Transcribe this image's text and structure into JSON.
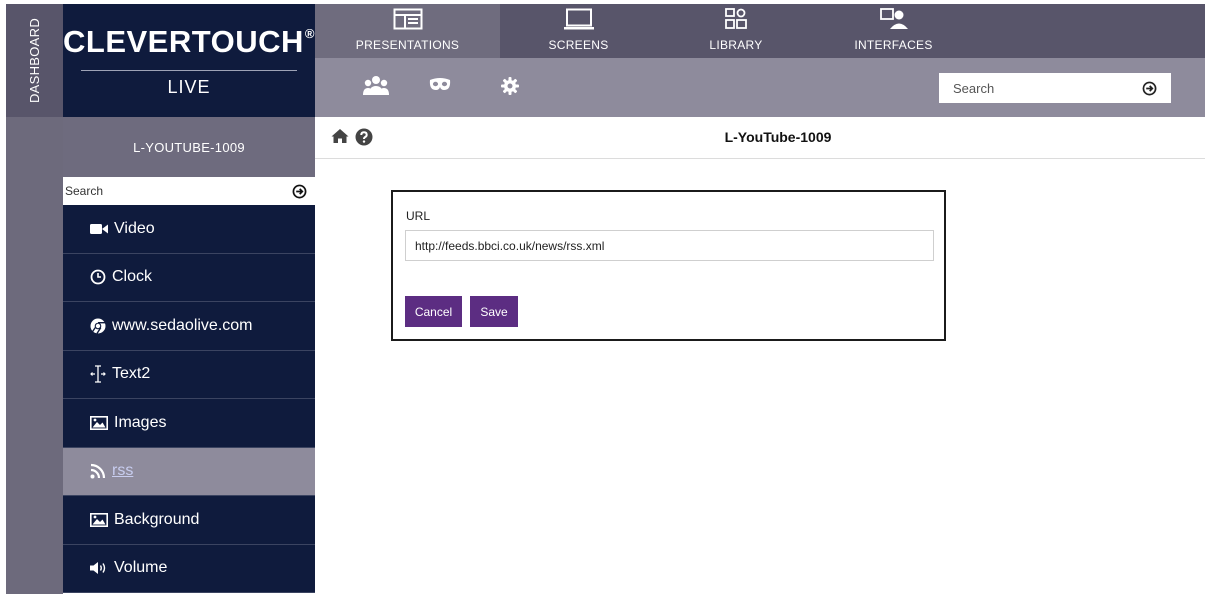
{
  "dashboard": {
    "label": "DASHBOARD"
  },
  "logo": {
    "brand": "CLEVERTOUCH",
    "mark": "®",
    "subtitle": "LIVE"
  },
  "topnav": {
    "tabs": [
      {
        "label": "PRESENTATIONS",
        "icon": "presentations-icon",
        "active": true
      },
      {
        "label": "SCREENS",
        "icon": "screens-icon",
        "active": false
      },
      {
        "label": "LIBRARY",
        "icon": "library-icon",
        "active": false
      },
      {
        "label": "INTERFACES",
        "icon": "interfaces-icon",
        "active": false
      }
    ]
  },
  "subnav": {
    "icons": [
      "users-icon",
      "mask-icon",
      "gear-icon"
    ],
    "search": {
      "placeholder": "Search",
      "icon": "arrow-circle-icon"
    }
  },
  "sidebar": {
    "presentation_name": "L-YOUTUBE-1009",
    "search": {
      "placeholder": "Search",
      "icon": "arrow-circle-icon"
    },
    "items": [
      {
        "label": "Video",
        "icon": "video-camera-icon",
        "active": false
      },
      {
        "label": "Clock",
        "icon": "clock-icon",
        "active": false
      },
      {
        "label": "www.sedaolive.com",
        "icon": "chrome-icon",
        "active": false
      },
      {
        "label": "Text2",
        "icon": "text-cursor-icon",
        "active": false
      },
      {
        "label": "Images",
        "icon": "image-icon",
        "active": false
      },
      {
        "label": "rss",
        "icon": "rss-icon",
        "active": true
      },
      {
        "label": "Background",
        "icon": "image-icon",
        "active": false
      },
      {
        "label": "Volume",
        "icon": "volume-icon",
        "active": false
      }
    ]
  },
  "main": {
    "title": "L-YouTube-1009",
    "form": {
      "url_label": "URL",
      "url_value": "http://feeds.bbci.co.uk/news/rss.xml",
      "cancel_label": "Cancel",
      "save_label": "Save"
    }
  },
  "colors": {
    "navy": "#0f1b3d",
    "nav_dark": "#58556a",
    "nav_mid": "#8e8b9c",
    "accent_purple": "#5c2d82"
  }
}
